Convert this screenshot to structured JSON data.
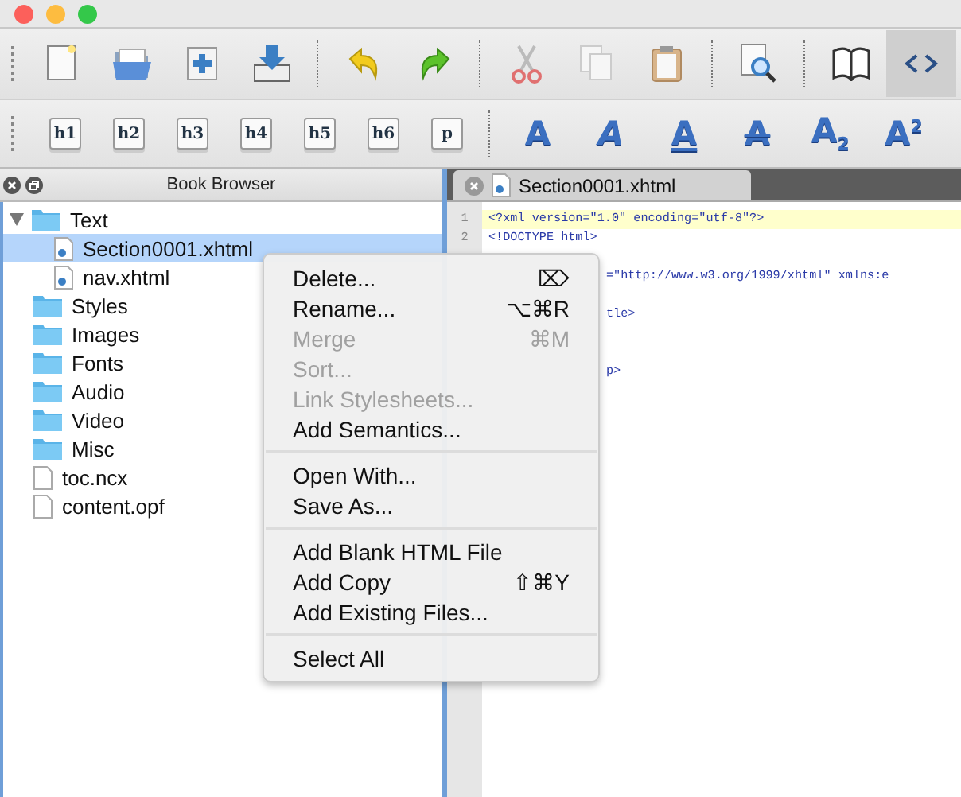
{
  "window": {
    "buttons": [
      {
        "kind": "close"
      },
      {
        "kind": "minimize"
      },
      {
        "kind": "zoom"
      }
    ]
  },
  "toolbar": [
    {
      "kind": "new",
      "selected": false
    },
    {
      "kind": "open",
      "selected": false
    },
    {
      "kind": "add",
      "selected": false
    },
    {
      "kind": "save",
      "selected": false
    },
    {
      "kind": "sep"
    },
    {
      "kind": "undo",
      "selected": false
    },
    {
      "kind": "redo",
      "selected": false
    },
    {
      "kind": "sep"
    },
    {
      "kind": "cut",
      "selected": false
    },
    {
      "kind": "copy",
      "selected": false
    },
    {
      "kind": "paste",
      "selected": false
    },
    {
      "kind": "sep"
    },
    {
      "kind": "find",
      "selected": false
    },
    {
      "kind": "sep"
    },
    {
      "kind": "book",
      "selected": false
    },
    {
      "kind": "code",
      "selected": true
    }
  ],
  "heading_buttons": [
    "h1",
    "h2",
    "h3",
    "h4",
    "h5",
    "h6",
    "p"
  ],
  "format_buttons": [
    {
      "kind": "bold",
      "label": "A"
    },
    {
      "kind": "italic",
      "label": "A"
    },
    {
      "kind": "underline",
      "label": "A"
    },
    {
      "kind": "strike",
      "label": "A"
    },
    {
      "kind": "subscript",
      "label": "A",
      "index": "2"
    },
    {
      "kind": "superscript",
      "label": "A",
      "index": "2"
    }
  ],
  "book_browser": {
    "title": "Book Browser",
    "tree": [
      {
        "label": "Text",
        "kind": "folder",
        "expanded": true,
        "selected": false,
        "children": [
          {
            "label": "Section0001.xhtml",
            "kind": "html",
            "selected": true
          },
          {
            "label": "nav.xhtml",
            "kind": "html",
            "selected": false
          }
        ]
      },
      {
        "label": "Styles",
        "kind": "folder",
        "selected": false
      },
      {
        "label": "Images",
        "kind": "folder",
        "selected": false
      },
      {
        "label": "Fonts",
        "kind": "folder",
        "selected": false
      },
      {
        "label": "Audio",
        "kind": "folder",
        "selected": false
      },
      {
        "label": "Video",
        "kind": "folder",
        "selected": false
      },
      {
        "label": "Misc",
        "kind": "folder",
        "selected": false
      },
      {
        "label": "toc.ncx",
        "kind": "file",
        "selected": false
      },
      {
        "label": "content.opf",
        "kind": "file",
        "selected": false
      }
    ]
  },
  "editor": {
    "tab": {
      "label": "Section0001.xhtml"
    },
    "lines": [
      {
        "number": "1",
        "text": "<?xml version=\"1.0\" encoding=\"utf-8\"?>",
        "current": true
      },
      {
        "number": "2",
        "text": "<!DOCTYPE html>",
        "current": false
      }
    ],
    "fragments": [
      "=\"http://www.w3.org/1999/xhtml\" xmlns:e",
      "tle>",
      "p>"
    ]
  },
  "context_menu": [
    [
      {
        "label": "Delete...",
        "shortcut": "⌦",
        "disabled": false
      },
      {
        "label": "Rename...",
        "shortcut": "⌥⌘R",
        "disabled": false
      },
      {
        "label": "Merge",
        "shortcut": "⌘M",
        "disabled": true
      },
      {
        "label": "Sort...",
        "disabled": true
      },
      {
        "label": "Link Stylesheets...",
        "disabled": true
      },
      {
        "label": "Add Semantics...",
        "disabled": false
      }
    ],
    [
      {
        "label": "Open With...",
        "disabled": false
      },
      {
        "label": "Save As...",
        "disabled": false
      }
    ],
    [
      {
        "label": "Add Blank HTML File",
        "disabled": false
      },
      {
        "label": "Add Copy",
        "shortcut": "⇧⌘Y",
        "disabled": false
      },
      {
        "label": "Add Existing Files...",
        "disabled": false
      }
    ],
    [
      {
        "label": "Select All",
        "disabled": false
      }
    ]
  ]
}
